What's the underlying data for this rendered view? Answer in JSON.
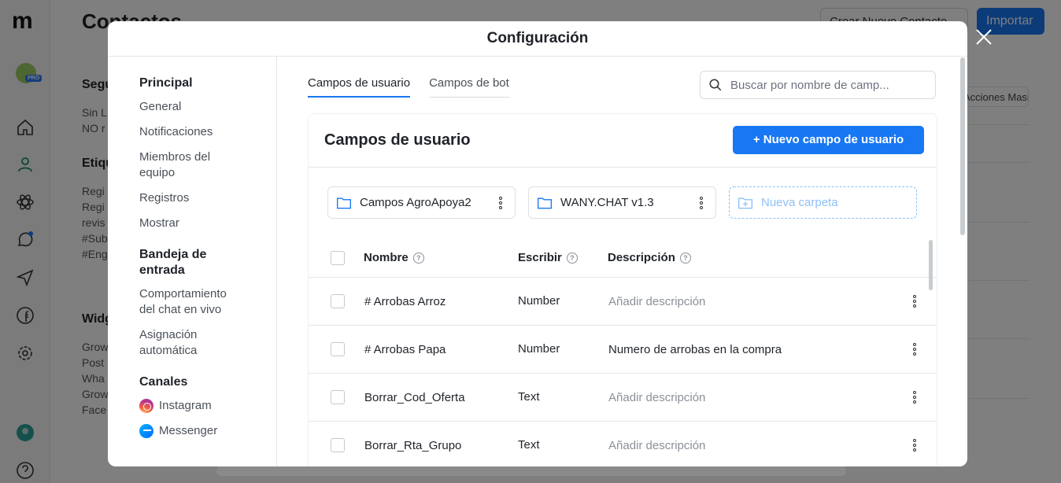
{
  "background": {
    "page_title": "Contactos",
    "create_contact_label": "Crear Nuevo Contacto",
    "import_label": "Importar",
    "pro_badge": "PRO",
    "masivas_label": "Acciones Masivas",
    "sections": [
      {
        "title": "Seguimiento",
        "lines": [
          "Sin L",
          "NO r"
        ]
      },
      {
        "title": "Etiquetas",
        "lines": [
          "Regi",
          "Regi",
          "revis",
          "#Sub",
          "#Eng"
        ]
      },
      {
        "title": "Widgets",
        "lines": [
          "Grow",
          "Post",
          "Wha",
          "Grow",
          "Face"
        ]
      }
    ]
  },
  "modal": {
    "title": "Configuración",
    "nav": {
      "principal": {
        "heading": "Principal",
        "items": [
          "General",
          "Notificaciones",
          "Miembros del equipo",
          "Registros",
          "Mostrar"
        ]
      },
      "bandeja": {
        "heading": "Bandeja de entrada",
        "items": [
          "Comportamiento del chat en vivo",
          "Asignación automática"
        ]
      },
      "canales": {
        "heading": "Canales",
        "items": [
          {
            "label": "Instagram",
            "icon": "instagram-icon"
          },
          {
            "label": "Messenger",
            "icon": "messenger-icon"
          }
        ]
      }
    },
    "tabs": [
      {
        "label": "Campos de usuario",
        "active": true
      },
      {
        "label": "Campos de bot",
        "active": false
      }
    ],
    "search": {
      "placeholder": "Buscar por nombre de camp..."
    },
    "card": {
      "title": "Campos de usuario",
      "new_field_button": "+ Nuevo campo de usuario",
      "folders": [
        "Campos AgroApoya2",
        "WANY.CHAT v1.3"
      ],
      "new_folder_label": "Nueva carpeta",
      "columns": {
        "name": "Nombre",
        "type": "Escribir",
        "description": "Descripción"
      },
      "rows": [
        {
          "name": "# Arrobas Arroz",
          "type": "Number",
          "description": "Añadir descripción",
          "placeholder": true
        },
        {
          "name": "# Arrobas Papa",
          "type": "Number",
          "description": "Numero de arrobas en la compra",
          "placeholder": false
        },
        {
          "name": "Borrar_Cod_Oferta",
          "type": "Text",
          "description": "Añadir descripción",
          "placeholder": true
        },
        {
          "name": "Borrar_Rta_Grupo",
          "type": "Text",
          "description": "Añadir descripción",
          "placeholder": true
        }
      ]
    }
  },
  "colors": {
    "accent": "#1877f2",
    "overlay": "rgba(0,0,0,0.5)",
    "muted_text": "#8a9099",
    "dashed_folder": "#8ec0f7"
  }
}
